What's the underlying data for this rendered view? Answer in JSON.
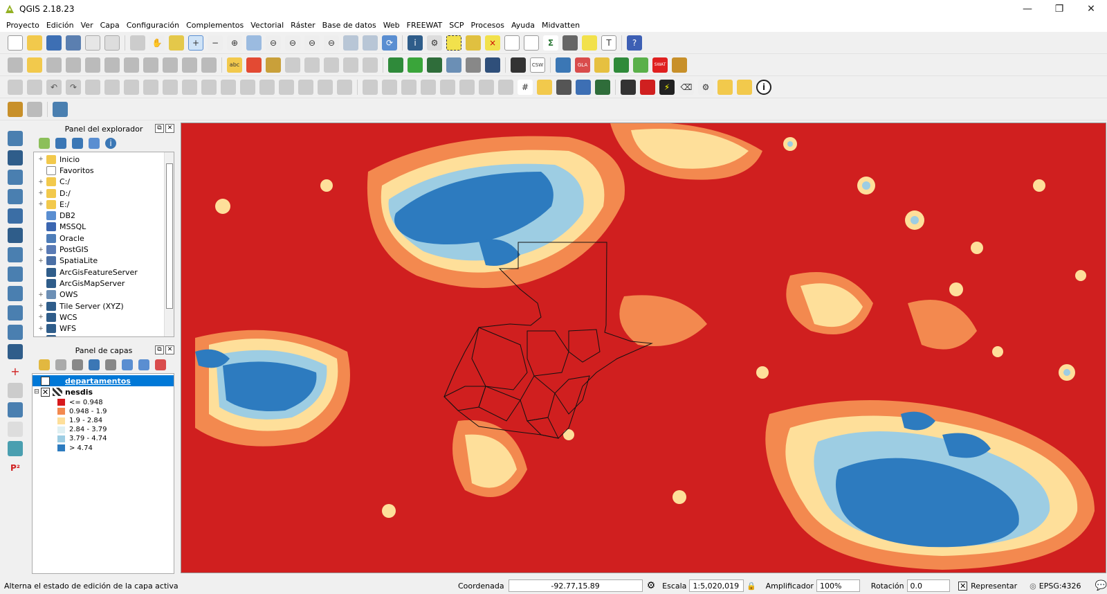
{
  "window": {
    "title": "QGIS 2.18.23",
    "controls": [
      "—",
      "❐",
      "✕"
    ]
  },
  "menu": [
    "Proyecto",
    "Edición",
    "Ver",
    "Capa",
    "Configuración",
    "Complementos",
    "Vectorial",
    "Ráster",
    "Base de datos",
    "Web",
    "FREEWAT",
    "SCP",
    "Procesos",
    "Ayuda",
    "Midvatten"
  ],
  "browser_panel": {
    "title": "Panel del explorador",
    "items": [
      {
        "label": "Inicio",
        "icon": "folder-icon",
        "color": "#f2c94c",
        "expand": "+"
      },
      {
        "label": "Favoritos",
        "icon": "star-icon",
        "color": "#ffffff",
        "expand": ""
      },
      {
        "label": "C:/",
        "icon": "folder-icon",
        "color": "#f2c94c",
        "expand": "+"
      },
      {
        "label": "D:/",
        "icon": "folder-icon",
        "color": "#f2c94c",
        "expand": "+"
      },
      {
        "label": "E:/",
        "icon": "folder-icon",
        "color": "#f2c94c",
        "expand": "+"
      },
      {
        "label": "DB2",
        "icon": "db2-icon",
        "color": "#5a8ed1",
        "expand": ""
      },
      {
        "label": "MSSQL",
        "icon": "mssql-icon",
        "color": "#3b66b0",
        "expand": ""
      },
      {
        "label": "Oracle",
        "icon": "oracle-icon",
        "color": "#4e7db8",
        "expand": ""
      },
      {
        "label": "PostGIS",
        "icon": "postgis-icon",
        "color": "#5a7bb5",
        "expand": "+"
      },
      {
        "label": "SpatiaLite",
        "icon": "spatialite-icon",
        "color": "#4a6fa5",
        "expand": "+"
      },
      {
        "label": "ArcGisFeatureServer",
        "icon": "globe-icon",
        "color": "#2f5d8a",
        "expand": ""
      },
      {
        "label": "ArcGisMapServer",
        "icon": "globe-icon",
        "color": "#2f5d8a",
        "expand": ""
      },
      {
        "label": "OWS",
        "icon": "globe-icon",
        "color": "#6c8fb5",
        "expand": "+"
      },
      {
        "label": "Tile Server (XYZ)",
        "icon": "globe-icon",
        "color": "#2f5d8a",
        "expand": "+"
      },
      {
        "label": "WCS",
        "icon": "globe-icon",
        "color": "#2f5d8a",
        "expand": "+"
      },
      {
        "label": "WFS",
        "icon": "globe-icon",
        "color": "#2f5d8a",
        "expand": "+"
      },
      {
        "label": "WMS",
        "icon": "globe-icon",
        "color": "#2f5d8a",
        "expand": "+"
      }
    ]
  },
  "layers_panel": {
    "title": "Panel de capas",
    "layers": [
      {
        "name": "departamentos",
        "checked": "✕",
        "selected": true
      },
      {
        "name": "nesdis",
        "checked": "✕",
        "selected": false
      }
    ],
    "legend": [
      {
        "label": "<= 0.948",
        "color": "#d7191c"
      },
      {
        "label": "0.948 - 1.9",
        "color": "#f3894f"
      },
      {
        "label": "1.9 - 2.84",
        "color": "#fedf9a"
      },
      {
        "label": "2.84 - 3.79",
        "color": "#dff0f3"
      },
      {
        "label": "3.79 - 4.74",
        "color": "#9dcde3"
      },
      {
        "label": "> 4.74",
        "color": "#2d7bbf"
      }
    ]
  },
  "status": {
    "message": "Alterna el estado de edición de la capa activa",
    "coord_label": "Coordenada",
    "coord_value": "-92.77,15.89",
    "scale_label": "Escala",
    "scale_value": "1:5,020,019",
    "magnifier_label": "Amplificador",
    "magnifier_value": "100%",
    "rotation_label": "Rotación",
    "rotation_value": "0.0",
    "render_label": "Representar",
    "crs": "EPSG:4326"
  },
  "colors": {
    "background_red": "#d01f1f",
    "accent_select": "#0078d7"
  }
}
